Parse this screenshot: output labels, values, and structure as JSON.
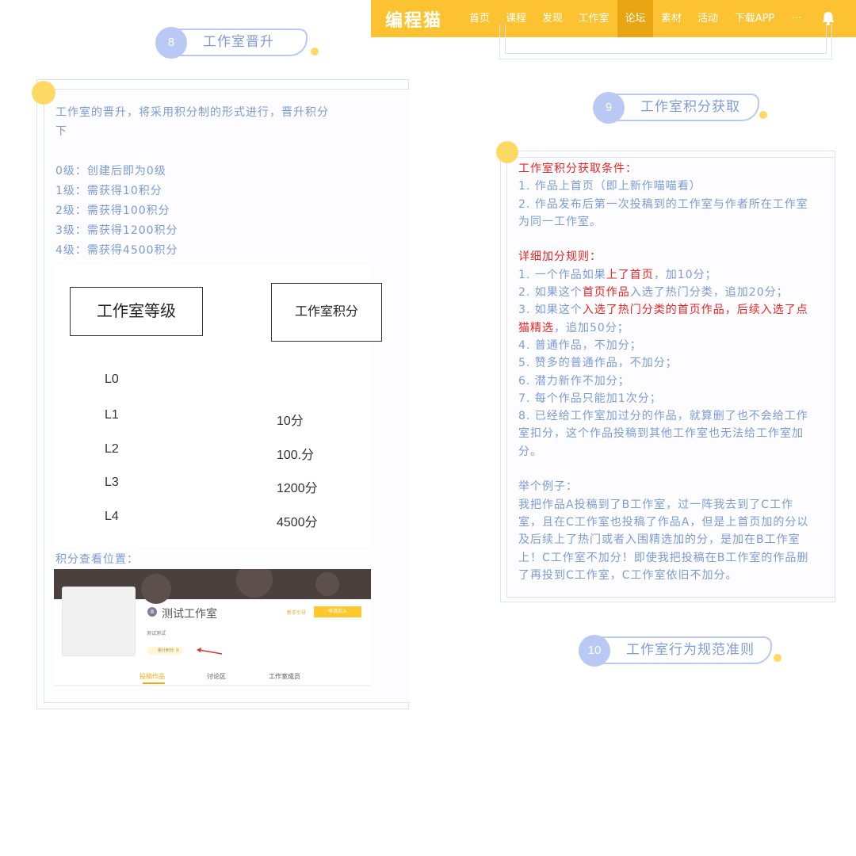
{
  "left": {
    "section": {
      "num": "8",
      "title": "工作室晋升"
    },
    "intro_line1": "工作室的晋升，将采用积分制的形式进行，晋升积分",
    "intro_line2": "下",
    "levels": [
      "0级：创建后即为0级",
      "1级：需获得10积分",
      "2级：需获得100积分",
      "3级：需获得1200积分",
      "4级：需获得4500积分"
    ],
    "table": {
      "header_level": "工作室等级",
      "header_points": "工作室积分",
      "rows": [
        {
          "level": "L0",
          "points": ""
        },
        {
          "level": "L1",
          "points": "10分"
        },
        {
          "level": "L2",
          "points": "100.分"
        },
        {
          "level": "L3",
          "points": "1200分"
        },
        {
          "level": "L4",
          "points": "4500分"
        }
      ]
    },
    "points_location_label": "积分查看位置：",
    "preview": {
      "avatar_text": "8",
      "studio_name": "测试工作室",
      "studio_desc": "测试测试",
      "points_badge": "累计积分: 0",
      "guide_link": "新手引导",
      "join_button": "申请加入",
      "tabs": [
        "投稿作品",
        "讨论区",
        "工作室成员"
      ]
    }
  },
  "nav": {
    "logo": "编程猫",
    "items": [
      "首页",
      "课程",
      "发现",
      "工作室",
      "论坛",
      "素材",
      "活动",
      "下载APP",
      "···"
    ],
    "active_index": 4,
    "accent": "#fdc231",
    "active_bg": "#eaa612"
  },
  "right": {
    "section9": {
      "num": "9",
      "title": "工作室积分获取"
    },
    "cond_title": "工作室积分获取条件：",
    "cond_1": "1. 作品上首页（即上新作喵喵看）",
    "cond_2a": "2.  作品发布后第一次投稿到的工作室与作者所在工作室",
    "cond_2b": "为同一工作室。",
    "rules_title": "详细加分规则：",
    "rule1": {
      "pre": "1. 一个作品如果",
      "hl": "上了首页",
      "post": "，加10分；"
    },
    "rule2": {
      "pre": "2. 如果这个",
      "hl": "首页作品",
      "post": "入选了热门分类，追加20分；"
    },
    "rule3": {
      "pre": "3.  如果这个",
      "hl": "入选了热门分类的首页作品，后续入选了点",
      "hl2": "猫精选",
      "post": "，追加50分；"
    },
    "rule4": "4. 普通作品，不加分；",
    "rule5": "5. 赞多的普通作品，不加分；",
    "rule6": "6. 潜力新作不加分；",
    "rule7": "7. 每个作品只能加1次分；",
    "rule8a": "8.  已经给工作室加过分的作品，就算删了也不会给工作",
    "rule8b": "室扣分，这个作品投稿到其他工作室也无法给工作室加",
    "rule8c": "分。",
    "example_title": "举个例子：",
    "example_lines": [
      "我把作品A投稿到了B工作室，过一阵我去到了C工作",
      "室，且在C工作室也投稿了作品A，但是上首页加的分以",
      "及后续上了热门或者入围精选加的分，是加在B工作室",
      "上！C工作室不加分！即使我把投稿在B工作室的作品删",
      "了再投到C工作室，C工作室依旧不加分。"
    ],
    "section10": {
      "num": "10",
      "title": "工作室行为规范准则"
    }
  },
  "colors": {
    "text_blue": "#7b9bd6",
    "highlight_red": "#ee2222",
    "dot_yellow": "#ffd966",
    "badge_blue": "#b9c9f4"
  }
}
